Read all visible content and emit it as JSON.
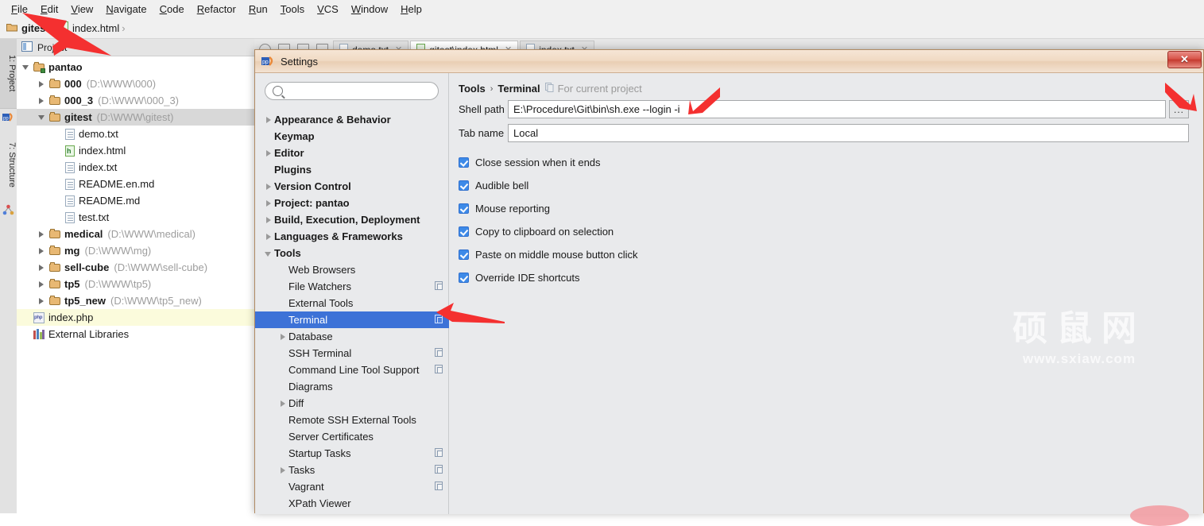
{
  "app": {
    "menu": [
      "File",
      "Edit",
      "View",
      "Navigate",
      "Code",
      "Refactor",
      "Run",
      "Tools",
      "VCS",
      "Window",
      "Help"
    ],
    "breadcrumb": [
      {
        "label": "gitest",
        "icon": "folder-icon",
        "bold": true
      },
      {
        "label": "index.html",
        "icon": "html-file-icon",
        "bold": false
      }
    ],
    "side_tabs": [
      {
        "label": "1: Project",
        "icon": "php-storm-icon"
      },
      {
        "label": "7: Structure",
        "icon": "structure-icon"
      }
    ],
    "project_panel": {
      "title": "Project",
      "items": [
        {
          "label": "pantao",
          "path": "",
          "type": "module",
          "indent": 0,
          "twisty": "down",
          "state": "normal"
        },
        {
          "label": "000",
          "path": "(D:\\WWW\\000)",
          "type": "folder",
          "indent": 1,
          "twisty": "right",
          "state": "normal"
        },
        {
          "label": "000_3",
          "path": "(D:\\WWW\\000_3)",
          "type": "folder",
          "indent": 1,
          "twisty": "right",
          "state": "normal"
        },
        {
          "label": "gitest",
          "path": "(D:\\WWW\\gitest)",
          "type": "folder",
          "indent": 1,
          "twisty": "down",
          "state": "selected"
        },
        {
          "label": "demo.txt",
          "path": "",
          "type": "file",
          "indent": 2,
          "twisty": "none",
          "state": "normal"
        },
        {
          "label": "index.html",
          "path": "",
          "type": "html",
          "indent": 2,
          "twisty": "none",
          "state": "normal"
        },
        {
          "label": "index.txt",
          "path": "",
          "type": "file",
          "indent": 2,
          "twisty": "none",
          "state": "normal"
        },
        {
          "label": "README.en.md",
          "path": "",
          "type": "file",
          "indent": 2,
          "twisty": "none",
          "state": "normal"
        },
        {
          "label": "README.md",
          "path": "",
          "type": "file",
          "indent": 2,
          "twisty": "none",
          "state": "normal"
        },
        {
          "label": "test.txt",
          "path": "",
          "type": "file",
          "indent": 2,
          "twisty": "none",
          "state": "normal"
        },
        {
          "label": "medical",
          "path": "(D:\\WWW\\medical)",
          "type": "folder",
          "indent": 1,
          "twisty": "right",
          "state": "normal"
        },
        {
          "label": "mg",
          "path": "(D:\\WWW\\mg)",
          "type": "folder",
          "indent": 1,
          "twisty": "right",
          "state": "normal"
        },
        {
          "label": "sell-cube",
          "path": "(D:\\WWW\\sell-cube)",
          "type": "folder",
          "indent": 1,
          "twisty": "right",
          "state": "normal"
        },
        {
          "label": "tp5",
          "path": "(D:\\WWW\\tp5)",
          "type": "folder",
          "indent": 1,
          "twisty": "right",
          "state": "normal"
        },
        {
          "label": "tp5_new",
          "path": "(D:\\WWW\\tp5_new)",
          "type": "folder",
          "indent": 1,
          "twisty": "right",
          "state": "normal"
        },
        {
          "label": "index.php",
          "path": "",
          "type": "php",
          "indent": 0,
          "twisty": "none",
          "state": "highlight"
        },
        {
          "label": "External Libraries",
          "path": "",
          "type": "library",
          "indent": 0,
          "twisty": "none",
          "state": "normal"
        }
      ]
    },
    "editor_tabs": [
      {
        "label": "demo.txt",
        "active": false
      },
      {
        "label": "gitest\\index.html",
        "active": true
      },
      {
        "label": "index.txt",
        "active": false
      }
    ]
  },
  "dialog": {
    "title": "Settings",
    "close_label": "✕",
    "search": {
      "value": "",
      "placeholder": ""
    },
    "tree": [
      {
        "label": "Appearance & Behavior",
        "level": 1,
        "twisty": "right",
        "copy": false,
        "selected": false
      },
      {
        "label": "Keymap",
        "level": 1,
        "twisty": "none",
        "copy": false,
        "selected": false
      },
      {
        "label": "Editor",
        "level": 1,
        "twisty": "right",
        "copy": false,
        "selected": false
      },
      {
        "label": "Plugins",
        "level": 1,
        "twisty": "none",
        "copy": false,
        "selected": false
      },
      {
        "label": "Version Control",
        "level": 1,
        "twisty": "right",
        "copy": false,
        "selected": false
      },
      {
        "label": "Project: pantao",
        "level": 1,
        "twisty": "right",
        "copy": false,
        "selected": false
      },
      {
        "label": "Build, Execution, Deployment",
        "level": 1,
        "twisty": "right",
        "copy": false,
        "selected": false
      },
      {
        "label": "Languages & Frameworks",
        "level": 1,
        "twisty": "right",
        "copy": false,
        "selected": false
      },
      {
        "label": "Tools",
        "level": 1,
        "twisty": "down",
        "copy": false,
        "selected": false
      },
      {
        "label": "Web Browsers",
        "level": 2,
        "twisty": "none",
        "copy": false,
        "selected": false
      },
      {
        "label": "File Watchers",
        "level": 2,
        "twisty": "none",
        "copy": true,
        "selected": false
      },
      {
        "label": "External Tools",
        "level": 2,
        "twisty": "none",
        "copy": false,
        "selected": false
      },
      {
        "label": "Terminal",
        "level": 2,
        "twisty": "none",
        "copy": true,
        "selected": true
      },
      {
        "label": "Database",
        "level": 2,
        "twisty": "right",
        "copy": false,
        "selected": false
      },
      {
        "label": "SSH Terminal",
        "level": 2,
        "twisty": "none",
        "copy": true,
        "selected": false
      },
      {
        "label": "Command Line Tool Support",
        "level": 2,
        "twisty": "none",
        "copy": true,
        "selected": false
      },
      {
        "label": "Diagrams",
        "level": 2,
        "twisty": "none",
        "copy": false,
        "selected": false
      },
      {
        "label": "Diff",
        "level": 2,
        "twisty": "right",
        "copy": false,
        "selected": false
      },
      {
        "label": "Remote SSH External Tools",
        "level": 2,
        "twisty": "none",
        "copy": false,
        "selected": false
      },
      {
        "label": "Server Certificates",
        "level": 2,
        "twisty": "none",
        "copy": false,
        "selected": false
      },
      {
        "label": "Startup Tasks",
        "level": 2,
        "twisty": "none",
        "copy": true,
        "selected": false
      },
      {
        "label": "Tasks",
        "level": 2,
        "twisty": "right",
        "copy": true,
        "selected": false
      },
      {
        "label": "Vagrant",
        "level": 2,
        "twisty": "none",
        "copy": true,
        "selected": false
      },
      {
        "label": "XPath Viewer",
        "level": 2,
        "twisty": "none",
        "copy": false,
        "selected": false
      }
    ],
    "panel": {
      "breadcrumb_root": "Tools",
      "breadcrumb_sep": "›",
      "breadcrumb_leaf": "Terminal",
      "scope_note": "For current project",
      "fields": [
        {
          "label": "Shell path",
          "value": "E:\\Procedure\\Git\\bin\\sh.exe --login -i"
        },
        {
          "label": "Tab name",
          "value": "Local"
        }
      ],
      "browse_label": "...",
      "checkboxes": [
        {
          "label": "Close session when it ends",
          "checked": true
        },
        {
          "label": "Audible bell",
          "checked": true
        },
        {
          "label": "Mouse reporting",
          "checked": true
        },
        {
          "label": "Copy to clipboard on selection",
          "checked": true
        },
        {
          "label": "Paste on middle mouse button click",
          "checked": true
        },
        {
          "label": "Override IDE shortcuts",
          "checked": true
        }
      ]
    }
  },
  "watermark": {
    "cn": "硕鼠网",
    "url": "www.sxiaw.com"
  },
  "colors": {
    "accent_blue": "#3d72d7",
    "checkbox_blue": "#3d8ae8",
    "annotation_red": "#f43030",
    "folder_gold": "#e8b873",
    "highlight_yellow": "#fbfbdc",
    "title_peach": "#f0d9c3"
  }
}
